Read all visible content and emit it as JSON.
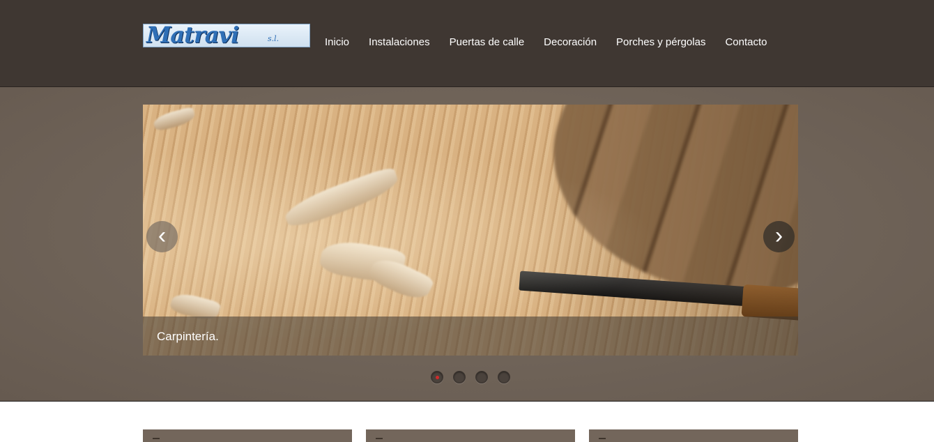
{
  "header": {
    "logo": {
      "text": "Matravi",
      "suffix": "s.l."
    },
    "nav": [
      {
        "label": "Inicio"
      },
      {
        "label": "Instalaciones"
      },
      {
        "label": "Puertas de calle"
      },
      {
        "label": "Decoración"
      },
      {
        "label": "Porches y pérgolas"
      },
      {
        "label": "Contacto"
      }
    ]
  },
  "slider": {
    "caption": "Carpintería.",
    "prev_icon": "chevron-left-icon",
    "next_icon": "chevron-right-icon",
    "prev_glyph": "‹",
    "next_glyph": "›",
    "dot_count": 4,
    "active_dot": 1
  },
  "colors": {
    "header_bg": "#3f3732",
    "band_bg": "#6f6358",
    "box_bg": "#73665b",
    "active_dot": "#d32a2a"
  }
}
